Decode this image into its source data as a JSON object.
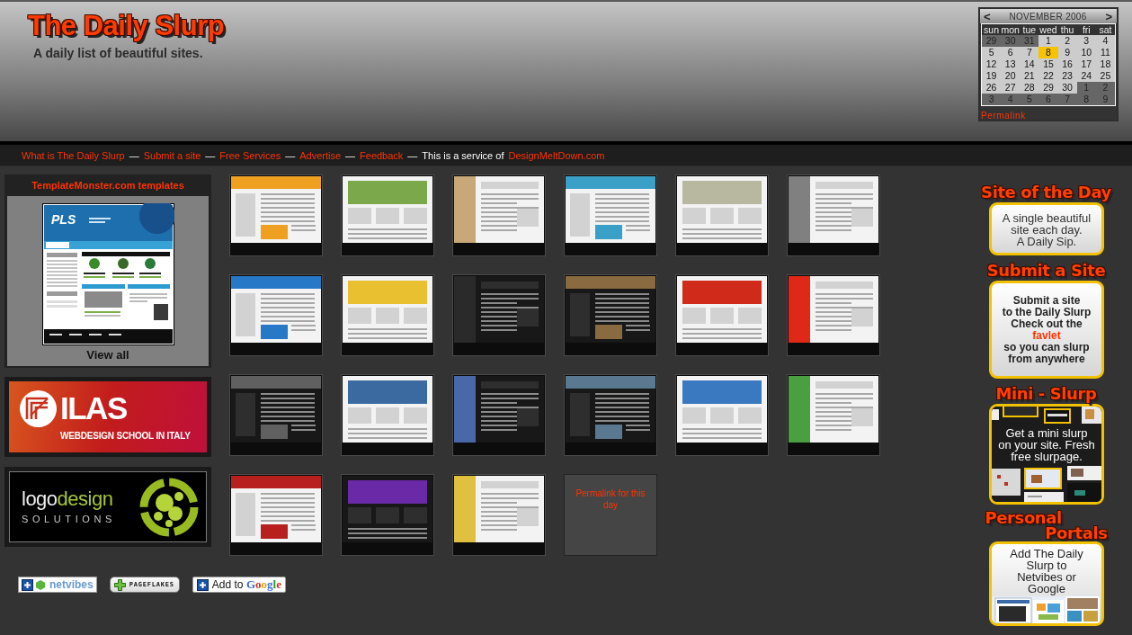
{
  "header": {
    "title": "The Daily Slurp",
    "tagline": "A daily list of beautiful sites."
  },
  "calendar": {
    "prev": "<",
    "month": "NOVEMBER 2006",
    "next": ">",
    "weekdays": [
      "sun",
      "mon",
      "tue",
      "wed",
      "thu",
      "fri",
      "sat"
    ],
    "weeks": [
      [
        {
          "day": "29",
          "other_month": true,
          "today": false
        },
        {
          "day": "30",
          "other_month": true,
          "today": false
        },
        {
          "day": "31",
          "other_month": true,
          "today": false
        },
        {
          "day": "1",
          "other_month": false,
          "today": false
        },
        {
          "day": "2",
          "other_month": false,
          "today": false
        },
        {
          "day": "3",
          "other_month": false,
          "today": false
        },
        {
          "day": "4",
          "other_month": false,
          "today": false
        }
      ],
      [
        {
          "day": "5",
          "other_month": false,
          "today": false
        },
        {
          "day": "6",
          "other_month": false,
          "today": false
        },
        {
          "day": "7",
          "other_month": false,
          "today": false
        },
        {
          "day": "8",
          "other_month": false,
          "today": true
        },
        {
          "day": "9",
          "other_month": false,
          "today": false
        },
        {
          "day": "10",
          "other_month": false,
          "today": false
        },
        {
          "day": "11",
          "other_month": false,
          "today": false
        }
      ],
      [
        {
          "day": "12",
          "other_month": false,
          "today": false
        },
        {
          "day": "13",
          "other_month": false,
          "today": false
        },
        {
          "day": "14",
          "other_month": false,
          "today": false
        },
        {
          "day": "15",
          "other_month": false,
          "today": false
        },
        {
          "day": "16",
          "other_month": false,
          "today": false
        },
        {
          "day": "17",
          "other_month": false,
          "today": false
        },
        {
          "day": "18",
          "other_month": false,
          "today": false
        }
      ],
      [
        {
          "day": "19",
          "other_month": false,
          "today": false
        },
        {
          "day": "20",
          "other_month": false,
          "today": false
        },
        {
          "day": "21",
          "other_month": false,
          "today": false
        },
        {
          "day": "22",
          "other_month": false,
          "today": false
        },
        {
          "day": "23",
          "other_month": false,
          "today": false
        },
        {
          "day": "24",
          "other_month": false,
          "today": false
        },
        {
          "day": "25",
          "other_month": false,
          "today": false
        }
      ],
      [
        {
          "day": "26",
          "other_month": false,
          "today": false
        },
        {
          "day": "27",
          "other_month": false,
          "today": false
        },
        {
          "day": "28",
          "other_month": false,
          "today": false
        },
        {
          "day": "29",
          "other_month": false,
          "today": false
        },
        {
          "day": "30",
          "other_month": false,
          "today": false
        },
        {
          "day": "1",
          "other_month": true,
          "today": false
        },
        {
          "day": "2",
          "other_month": true,
          "today": false
        }
      ],
      [
        {
          "day": "3",
          "other_month": true,
          "today": false
        },
        {
          "day": "4",
          "other_month": true,
          "today": false
        },
        {
          "day": "5",
          "other_month": true,
          "today": false
        },
        {
          "day": "6",
          "other_month": true,
          "today": false
        },
        {
          "day": "7",
          "other_month": true,
          "today": false
        },
        {
          "day": "8",
          "other_month": true,
          "today": false
        },
        {
          "day": "9",
          "other_month": true,
          "today": false
        }
      ]
    ],
    "permalink": "Permalink"
  },
  "nav": [
    {
      "kind": "link",
      "text": "What is The Daily Slurp"
    },
    {
      "kind": "separator",
      "text": "—"
    },
    {
      "kind": "link",
      "text": "Submit a site"
    },
    {
      "kind": "separator",
      "text": "—"
    },
    {
      "kind": "link",
      "text": "Free Services"
    },
    {
      "kind": "separator",
      "text": "—"
    },
    {
      "kind": "link",
      "text": "Advertise"
    },
    {
      "kind": "separator",
      "text": "—"
    },
    {
      "kind": "link",
      "text": "Feedback"
    },
    {
      "kind": "separator",
      "text": "—"
    },
    {
      "kind": "text",
      "text": "This is a service of"
    },
    {
      "kind": "link",
      "text": "DesignMeltDown.com"
    }
  ],
  "sidebar": {
    "template_box": {
      "heading": "TemplateMonster.com templates",
      "preview_title": "PLS",
      "link": "View all"
    },
    "banners": [
      {
        "kind": "ilas",
        "title": "ILAS",
        "subtitle": "WEBDESIGN SCHOOL IN ITALY"
      },
      {
        "kind": "logodesign",
        "title_parts": [
          "logo",
          "design"
        ],
        "subtitle": "SOLUTIONS"
      }
    ],
    "badges": [
      {
        "kind": "netvibes",
        "label": "netvibes"
      },
      {
        "kind": "pageflakes",
        "label": "PAGEFLAKES"
      },
      {
        "kind": "google",
        "label": "Add to",
        "brand": "Google"
      }
    ]
  },
  "thumbnails": [
    {
      "kind": "light",
      "color": "#f0a020"
    },
    {
      "kind": "light",
      "color": "#7aa84a"
    },
    {
      "kind": "light",
      "color": "#c8a878"
    },
    {
      "kind": "light",
      "color": "#3aa0c8"
    },
    {
      "kind": "light",
      "color": "#b8b8a0"
    },
    {
      "kind": "light",
      "color": "#808080"
    },
    {
      "kind": "light",
      "color": "#2878c8"
    },
    {
      "kind": "light",
      "color": "#e8c030"
    },
    {
      "kind": "dark",
      "color": "#2a2a2a"
    },
    {
      "kind": "dark",
      "color": "#8a6a40"
    },
    {
      "kind": "light",
      "color": "#d02a1a"
    },
    {
      "kind": "light",
      "color": "#e02818"
    },
    {
      "kind": "dark",
      "color": "#606060"
    },
    {
      "kind": "light",
      "color": "#3a6aa0"
    },
    {
      "kind": "dark",
      "color": "#4a68a8"
    },
    {
      "kind": "dark",
      "color": "#5a7890"
    },
    {
      "kind": "light",
      "color": "#3a78c0"
    },
    {
      "kind": "light",
      "color": "#4aa040"
    },
    {
      "kind": "light",
      "color": "#b82020"
    },
    {
      "kind": "dark",
      "color": "#6a2aa8"
    },
    {
      "kind": "light",
      "color": "#e0c040"
    },
    {
      "kind": "permalink",
      "text": "Permalink for this day"
    }
  ],
  "promos": [
    {
      "kind": "plain",
      "title": "Site of the Day",
      "text": "A single beautiful\nsite each day.\nA Daily Sip."
    },
    {
      "kind": "plain",
      "title": "Submit a Site",
      "text": "Submit a site\nto the Daily Slurp\nCheck out the",
      "link": "favlet",
      "text_after": "so you can slurp\nfrom anywhere"
    },
    {
      "kind": "collage",
      "title": "Mini - Slurp",
      "text": "Get a mini slurp\non your site. Fresh\nfree slurpage."
    },
    {
      "kind": "preview",
      "title": "Personal Portals",
      "text": "Add The Daily\nSlurp to\nNetvibes or\nGoogle"
    }
  ]
}
